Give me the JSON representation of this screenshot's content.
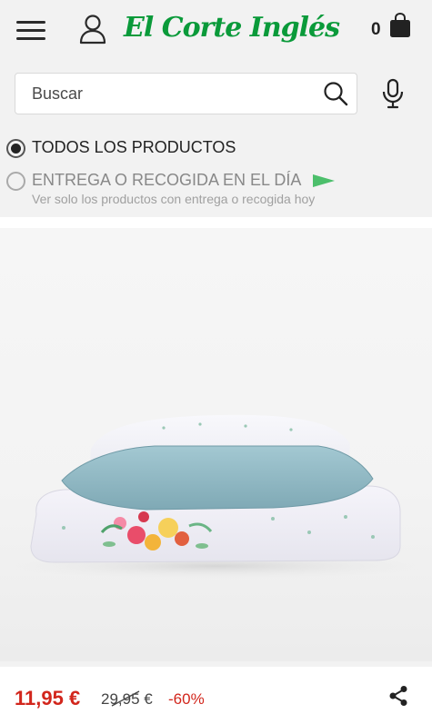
{
  "header": {
    "menu_icon": "hamburger-menu-icon",
    "user_icon": "user-account-icon",
    "logo_text": "El Corte Inglés",
    "cart_count": "0",
    "cart_icon": "shopping-bag-icon"
  },
  "search": {
    "placeholder": "Buscar",
    "search_icon": "search-icon",
    "mic_icon": "microphone-icon"
  },
  "filters": {
    "all_products_label": "TODOS LOS PRODUCTOS",
    "all_products_selected": true,
    "same_day_label": "ENTREGA O RECOGIDA EN EL DÍA",
    "same_day_selected": false,
    "same_day_sublabel": "Ver solo los productos con entrega o recogida hoy",
    "flag_icon": "green-flag-icon"
  },
  "product": {
    "image_icon": "bedding-set-image",
    "price_current": "11,95 €",
    "price_old": "29,95 €",
    "discount": "-60%",
    "share_icon": "share-icon"
  },
  "colors": {
    "brand_green": "#0a9a3a",
    "price_red": "#d2261c",
    "pillow_blue": "#8fb9c4"
  }
}
